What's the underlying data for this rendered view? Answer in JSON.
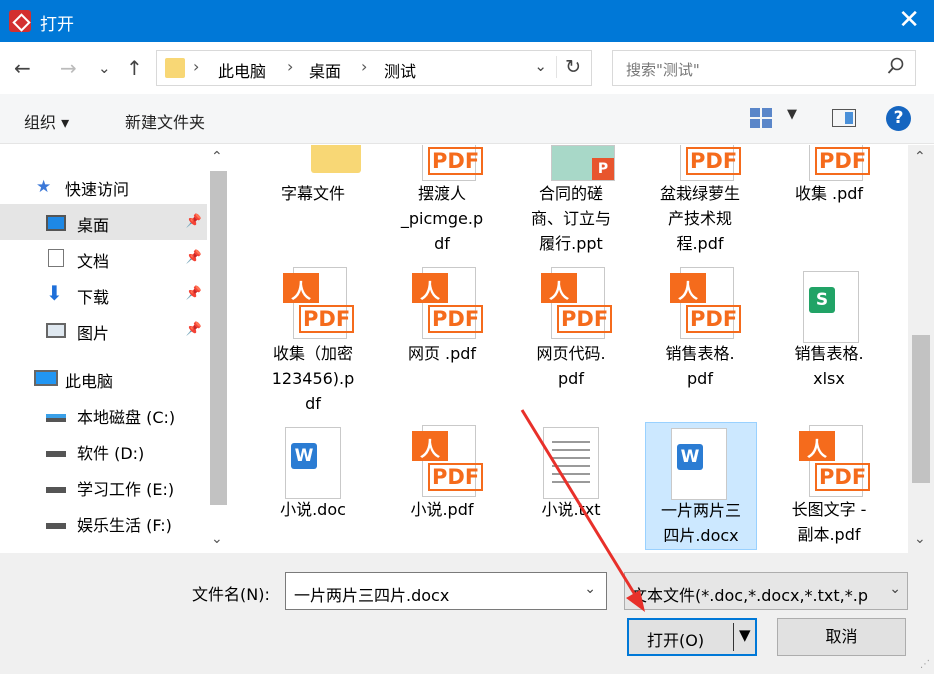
{
  "window": {
    "title": "打开",
    "close": "✕"
  },
  "nav": {
    "back": "←",
    "forward": "→",
    "recent": "⌄",
    "up": "↑",
    "breadcrumb": [
      "此电脑",
      "桌面",
      "测试"
    ],
    "search_placeholder": "搜索\"测试\""
  },
  "toolbar": {
    "organize": "组织 ▾",
    "new_folder": "新建文件夹",
    "help": "?"
  },
  "sidebar": {
    "items": [
      {
        "label": "快速访问",
        "icon": "star-icon",
        "pinned": false
      },
      {
        "label": "桌面",
        "icon": "desktop-icon",
        "pinned": true,
        "active": true
      },
      {
        "label": "文档",
        "icon": "document-icon",
        "pinned": true
      },
      {
        "label": "下载",
        "icon": "download-icon",
        "pinned": true
      },
      {
        "label": "图片",
        "icon": "picture-icon",
        "pinned": true
      },
      {
        "label": "此电脑",
        "icon": "computer-icon",
        "pinned": false
      },
      {
        "label": "本地磁盘 (C:)",
        "icon": "drive-icon",
        "pinned": false
      },
      {
        "label": "软件 (D:)",
        "icon": "drive-icon",
        "pinned": false
      },
      {
        "label": "学习工作 (E:)",
        "icon": "drive-icon",
        "pinned": false
      },
      {
        "label": "娱乐生活 (F:)",
        "icon": "drive-icon",
        "pinned": false
      }
    ]
  },
  "files": [
    {
      "name": "字幕文件",
      "type": "folder"
    },
    {
      "name": "摆渡人\n_picmge.p\ndf",
      "type": "pdf"
    },
    {
      "name": "合同的磋\n商、订立与\n履行.ppt",
      "type": "ppt"
    },
    {
      "name": "盆栽绿萝生\n产技术规\n程.pdf",
      "type": "pdf"
    },
    {
      "name": "收集 .pdf",
      "type": "pdf"
    },
    {
      "name": "收集（加密\n123456).p\ndf",
      "type": "pdf"
    },
    {
      "name": "网页 .pdf",
      "type": "pdf"
    },
    {
      "name": "网页代码.\npdf",
      "type": "pdf"
    },
    {
      "name": "销售表格.\npdf",
      "type": "pdf"
    },
    {
      "name": "销售表格.\nxlsx",
      "type": "xlsx"
    },
    {
      "name": "小说.doc",
      "type": "doc"
    },
    {
      "name": "小说.pdf",
      "type": "pdf"
    },
    {
      "name": "小说.txt",
      "type": "txt"
    },
    {
      "name": "一片两片三\n四片.docx",
      "type": "docx",
      "selected": true
    },
    {
      "name": "长图文字 -\n副本.pdf",
      "type": "pdf"
    }
  ],
  "footer": {
    "filename_label": "文件名(N):",
    "filename_value": "一片两片三四片.docx",
    "filetype_value": "文本文件(*.doc,*.docx,*.txt,*.p",
    "open": "打开(O)",
    "cancel": "取消"
  },
  "colors": {
    "accent": "#0078d7",
    "selection": "#cce8ff",
    "annotation": "#e8302a"
  }
}
